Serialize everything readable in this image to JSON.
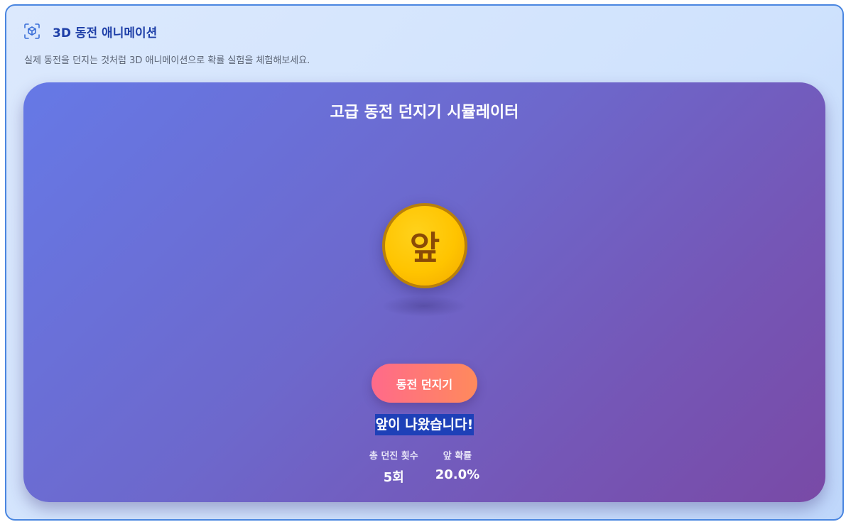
{
  "header": {
    "icon": "cube-scan-icon",
    "title": "3D 동전 애니메이션",
    "subtitle": "실제 동전을 던지는 것처럼 3D 애니메이션으로 확률 실험을 체험해보세요."
  },
  "simulator": {
    "title": "고급 동전 던지기 시뮬레이터",
    "coin_face": "앞",
    "toss_button_label": "동전 던지기",
    "result_text": "앞이 나왔습니다!",
    "stats": [
      {
        "label": "총 던진 횟수",
        "value": "5회"
      },
      {
        "label": "앞 확률",
        "value": "20.0%"
      }
    ]
  },
  "colors": {
    "accent": "#1e3fa8",
    "button_start": "#ff6a8a",
    "button_end": "#ff8a5c",
    "coin": "#ffc400",
    "result_highlight": "#1e40b8"
  }
}
